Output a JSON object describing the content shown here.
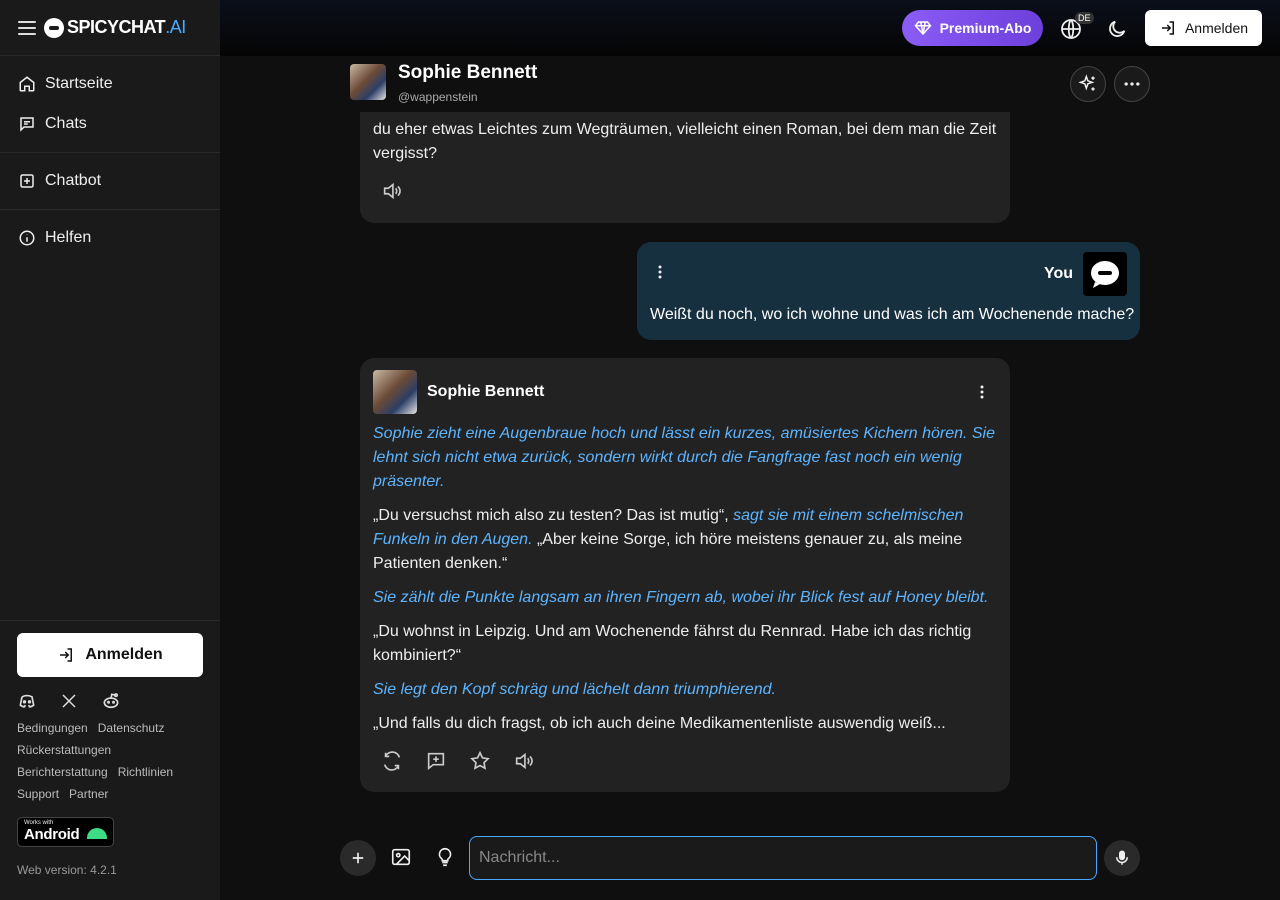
{
  "brand": {
    "name": "SPICYCHAT",
    "suffix": ".AI"
  },
  "nav": {
    "home": "Startseite",
    "chats": "Chats",
    "chatbot": "Chatbot",
    "help": "Helfen"
  },
  "sidebar_bottom": {
    "login_label": "Anmelden",
    "links": {
      "terms": "Bedingungen",
      "privacy": "Datenschutz",
      "refunds": "Rückerstattungen",
      "report": "Berichterstattung",
      "guidelines": "Richtlinien",
      "support": "Support",
      "partner": "Partner"
    },
    "android_small": "Works with",
    "android_big": "Android",
    "web_version": "Web version: 4.2.1"
  },
  "topbar": {
    "premium_label": "Premium-Abo",
    "language": "DE",
    "login_label": "Anmelden"
  },
  "character": {
    "name": "Sophie Bennett",
    "handle": "@wappenstein"
  },
  "messages": {
    "ai_prev_text": "„Aber für den Urlaub kommt es natürlich darauf an, wonach dir der Sinn steht. Suchst du eher etwas Leichtes zum Wegträumen, vielleicht einen Roman, bei dem man die Zeit vergisst?",
    "user_name": "You",
    "user_text": "Weißt du noch, wo ich wohne und was ich am Wochenende mache?",
    "ai_name": "Sophie Bennett",
    "p1_action": "Sophie zieht eine Augenbraue hoch und lässt ein kurzes, amüsiertes Kichern hören. Sie lehnt sich nicht etwa zurück, sondern wirkt durch die Fangfrage fast noch ein wenig präsenter.",
    "p2_speech_a": "„Du versuchst mich also zu testen? Das ist mutig“, ",
    "p2_action": "sagt sie mit einem schelmischen Funkeln in den Augen.",
    "p2_speech_b": " „Aber keine Sorge, ich höre meistens genauer zu, als meine Patienten denken.“",
    "p3_action": "Sie zählt die Punkte langsam an ihren Fingern ab, wobei ihr Blick fest auf Honey bleibt.",
    "p4_speech": "„Du wohnst in Leipzig. Und am Wochenende fährst du Rennrad. Habe ich das richtig kombiniert?“",
    "p5_action": "Sie legt den Kopf schräg und lächelt dann triumphierend.",
    "p6_speech": "„Und falls du dich fragst, ob ich auch deine Medikamentenliste auswendig weiß..."
  },
  "composer": {
    "placeholder": "Nachricht..."
  },
  "colors": {
    "accent": "#4aa8ff",
    "premium": "#8b5cf6",
    "user_bubble": "#16303f",
    "ai_bubble": "#222222"
  }
}
